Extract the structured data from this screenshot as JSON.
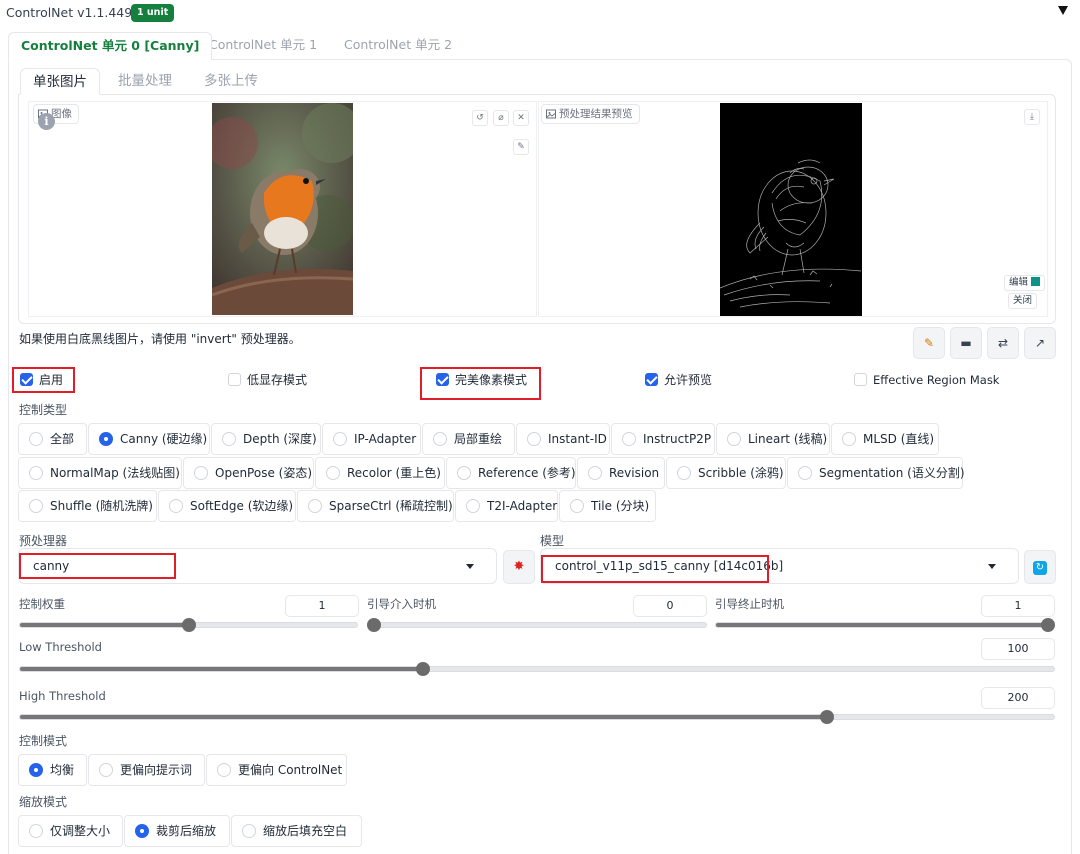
{
  "header": {
    "title": "ControlNet v1.1.449",
    "badge": "1 unit"
  },
  "unit_tabs": [
    {
      "label": "ControlNet 单元 0 [Canny]",
      "active": true
    },
    {
      "label": "ControlNet 单元 1",
      "active": false
    },
    {
      "label": "ControlNet 单元 2",
      "active": false
    }
  ],
  "input_tabs": [
    {
      "label": "单张图片",
      "active": true
    },
    {
      "label": "批量处理",
      "active": false
    },
    {
      "label": "多张上传",
      "active": false
    }
  ],
  "image_panel": {
    "label": "图像"
  },
  "preview_panel": {
    "label": "预处理结果预览",
    "edit_label": "编辑",
    "close_label": "关闭"
  },
  "hint": "如果使用白底黑线图片，请使用 \"invert\" 预处理器。",
  "options": [
    {
      "label": "启用",
      "checked": true
    },
    {
      "label": "低显存模式",
      "checked": false
    },
    {
      "label": "完美像素模式",
      "checked": true
    },
    {
      "label": "允许预览",
      "checked": true
    },
    {
      "label": "Effective Region Mask",
      "checked": false
    }
  ],
  "control_type": {
    "label": "控制类型",
    "selected": "Canny (硬边缘)",
    "rows": [
      [
        "全部",
        "Canny (硬边缘)",
        "Depth (深度)",
        "IP-Adapter",
        "局部重绘",
        "Instant-ID",
        "InstructP2P",
        "Lineart (线稿)",
        "MLSD (直线)"
      ],
      [
        "NormalMap (法线贴图)",
        "OpenPose (姿态)",
        "Recolor (重上色)",
        "Reference (参考)",
        "Revision",
        "Scribble (涂鸦)",
        "Segmentation (语义分割)"
      ],
      [
        "Shuffle (随机洗牌)",
        "SoftEdge (软边缘)",
        "SparseCtrl (稀疏控制)",
        "T2I-Adapter",
        "Tile (分块)"
      ]
    ]
  },
  "preprocessor": {
    "label": "预处理器",
    "value": "canny"
  },
  "model": {
    "label": "模型",
    "value": "control_v11p_sd15_canny [d14c016b]"
  },
  "sliders": {
    "weight": {
      "label": "控制权重",
      "value": "1",
      "fraction": 0.5
    },
    "start": {
      "label": "引导介入时机",
      "value": "0",
      "fraction": 0.0
    },
    "end": {
      "label": "引导终止时机",
      "value": "1",
      "fraction": 1.0
    },
    "low": {
      "label": "Low Threshold",
      "value": "100",
      "fraction": 0.39
    },
    "high": {
      "label": "High Threshold",
      "value": "200",
      "fraction": 0.78
    }
  },
  "control_mode": {
    "label": "控制模式",
    "options": [
      "均衡",
      "更偏向提示词",
      "更偏向 ControlNet"
    ],
    "selected": "均衡"
  },
  "resize_mode": {
    "label": "缩放模式",
    "options": [
      "仅调整大小",
      "裁剪后缩放",
      "缩放后填充空白"
    ],
    "selected": "裁剪后缩放"
  },
  "colors": {
    "accent": "#2563eb",
    "green": "#15803d",
    "highlight": "#e11d2a"
  }
}
